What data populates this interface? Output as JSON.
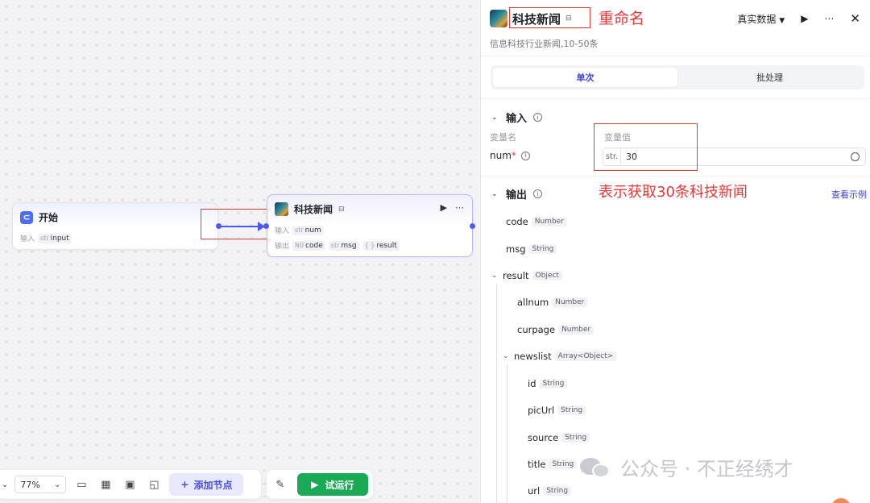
{
  "canvas": {
    "start_node": {
      "title": "开始",
      "input_label": "输入",
      "input_tag_type": "str",
      "input_tag_name": "input"
    },
    "news_node": {
      "title": "科技新闻",
      "input_label": "输入",
      "input_tag_type": "str",
      "input_tag_name": "num",
      "output_label": "输出",
      "outputs": [
        {
          "type": "N0",
          "name": "code"
        },
        {
          "type": "str",
          "name": "msg"
        },
        {
          "type": "{ }",
          "name": "result"
        }
      ]
    }
  },
  "toolbar": {
    "zoom": "77%",
    "add_node_label": "添加节点",
    "test_run_label": "试运行"
  },
  "panel": {
    "title": "科技新闻",
    "rename_annotation": "重命名",
    "data_mode": "真实数据",
    "subtitle": "信息科技行业新闻,10-50条",
    "tabs": [
      "单次",
      "批处理"
    ],
    "input_section": "输入",
    "col_var_name": "变量名",
    "col_var_value": "变量值",
    "var_name": "num",
    "var_required": "*",
    "var_type": "str.",
    "var_value": "30",
    "output_section": "输出",
    "output_annotation": "表示获取30条科技新闻",
    "view_example": "查看示例",
    "tree": [
      {
        "name": "code",
        "type": "Number"
      },
      {
        "name": "msg",
        "type": "String"
      },
      {
        "name": "result",
        "type": "Object"
      },
      {
        "name": "allnum",
        "type": "Number"
      },
      {
        "name": "curpage",
        "type": "Number"
      },
      {
        "name": "newslist",
        "type": "Array<Object>"
      },
      {
        "name": "id",
        "type": "String"
      },
      {
        "name": "picUrl",
        "type": "String"
      },
      {
        "name": "source",
        "type": "String"
      },
      {
        "name": "title",
        "type": "String"
      },
      {
        "name": "url",
        "type": "String"
      }
    ]
  },
  "watermark": "公众号 · 不正经绣才",
  "colors": {
    "accent": "#4e5bf2",
    "annotation": "#e5393a",
    "run_green": "#1aa954"
  }
}
